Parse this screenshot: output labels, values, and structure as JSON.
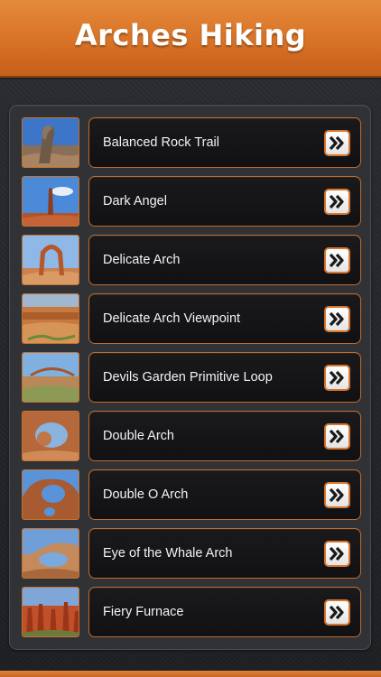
{
  "header": {
    "title": "Arches Hiking"
  },
  "colors": {
    "accent": "#d8782b",
    "panel": "#303236",
    "item_bg": "#151517"
  },
  "list": {
    "items": [
      {
        "label": "Balanced Rock Trail",
        "thumb_icon": "balanced-rock-photo-icon",
        "arrow_icon": "double-chevron-right-icon"
      },
      {
        "label": "Dark Angel",
        "thumb_icon": "dark-angel-photo-icon",
        "arrow_icon": "double-chevron-right-icon"
      },
      {
        "label": "Delicate Arch",
        "thumb_icon": "delicate-arch-photo-icon",
        "arrow_icon": "double-chevron-right-icon"
      },
      {
        "label": "Delicate Arch Viewpoint",
        "thumb_icon": "delicate-arch-viewpoint-photo-icon",
        "arrow_icon": "double-chevron-right-icon"
      },
      {
        "label": "Devils Garden Primitive Loop",
        "thumb_icon": "devils-garden-photo-icon",
        "arrow_icon": "double-chevron-right-icon"
      },
      {
        "label": "Double Arch",
        "thumb_icon": "double-arch-photo-icon",
        "arrow_icon": "double-chevron-right-icon"
      },
      {
        "label": "Double O Arch",
        "thumb_icon": "double-o-arch-photo-icon",
        "arrow_icon": "double-chevron-right-icon"
      },
      {
        "label": "Eye of the Whale Arch",
        "thumb_icon": "eye-of-the-whale-photo-icon",
        "arrow_icon": "double-chevron-right-icon"
      },
      {
        "label": "Fiery Furnace",
        "thumb_icon": "fiery-furnace-photo-icon",
        "arrow_icon": "double-chevron-right-icon"
      }
    ]
  }
}
